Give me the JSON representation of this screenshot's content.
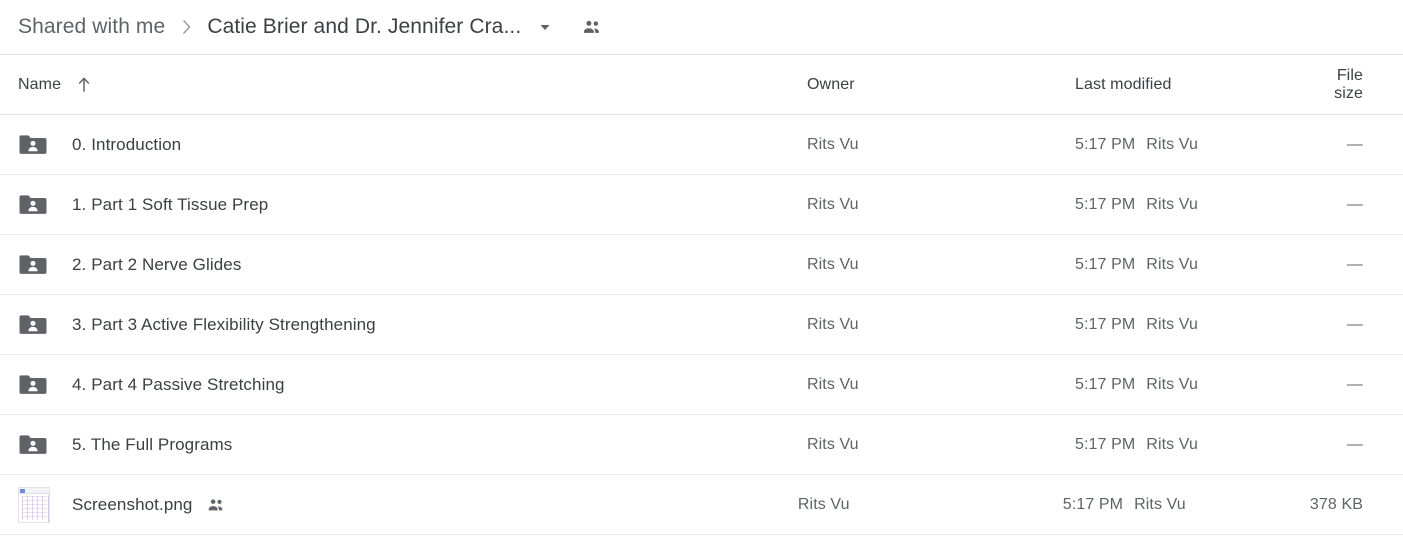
{
  "breadcrumb": {
    "root_label": "Shared with me",
    "separator": "›",
    "current_label": "Catie Brier and Dr. Jennifer Cra...",
    "caret_icon": "chevron-down-icon",
    "people_icon": "people-shared-icon"
  },
  "table": {
    "columns": {
      "name": "Name",
      "owner": "Owner",
      "modified": "Last modified",
      "size": "File size"
    },
    "sort": {
      "column": "Name",
      "direction": "ascending",
      "icon": "arrow-up-icon"
    },
    "rows": [
      {
        "icon": "shared-folder-icon",
        "name": "0. Introduction",
        "owner": "Rits Vu",
        "modified_time": "5:17 PM",
        "modified_by": "Rits Vu",
        "size": "—",
        "shared_badge": false
      },
      {
        "icon": "shared-folder-icon",
        "name": "1. Part 1 Soft Tissue Prep",
        "owner": "Rits Vu",
        "modified_time": "5:17 PM",
        "modified_by": "Rits Vu",
        "size": "—",
        "shared_badge": false
      },
      {
        "icon": "shared-folder-icon",
        "name": "2. Part 2 Nerve Glides",
        "owner": "Rits Vu",
        "modified_time": "5:17 PM",
        "modified_by": "Rits Vu",
        "size": "—",
        "shared_badge": false
      },
      {
        "icon": "shared-folder-icon",
        "name": "3. Part 3 Active Flexibility Strengthening",
        "owner": "Rits Vu",
        "modified_time": "5:17 PM",
        "modified_by": "Rits Vu",
        "size": "—",
        "shared_badge": false
      },
      {
        "icon": "shared-folder-icon",
        "name": "4. Part 4 Passive Stretching",
        "owner": "Rits Vu",
        "modified_time": "5:17 PM",
        "modified_by": "Rits Vu",
        "size": "—",
        "shared_badge": false
      },
      {
        "icon": "shared-folder-icon",
        "name": "5. The Full Programs",
        "owner": "Rits Vu",
        "modified_time": "5:17 PM",
        "modified_by": "Rits Vu",
        "size": "—",
        "shared_badge": false
      },
      {
        "icon": "png-thumbnail-icon",
        "name": "Screenshot.png",
        "owner": "Rits Vu",
        "modified_time": "5:17 PM",
        "modified_by": "Rits Vu",
        "size": "378 KB",
        "shared_badge": true
      }
    ]
  },
  "colors": {
    "folder_icon": "#5f6368",
    "text_primary": "#3c4043",
    "text_secondary": "#5f6368",
    "divider": "#e8eaed",
    "background": "#ffffff"
  }
}
